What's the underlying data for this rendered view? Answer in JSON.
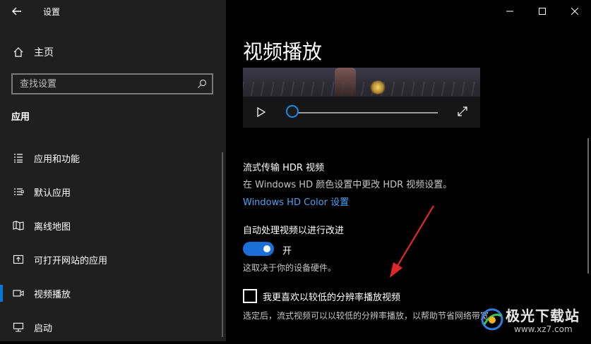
{
  "window": {
    "title": "设置"
  },
  "sidebar": {
    "home_label": "主页",
    "search_placeholder": "查找设置",
    "section_title": "应用",
    "items": [
      {
        "label": "应用和功能",
        "icon": "apps-list-icon"
      },
      {
        "label": "默认应用",
        "icon": "default-apps-icon"
      },
      {
        "label": "离线地图",
        "icon": "offline-map-icon"
      },
      {
        "label": "可打开网站的应用",
        "icon": "open-website-icon"
      },
      {
        "label": "视频播放",
        "icon": "video-playback-icon",
        "active": true
      },
      {
        "label": "启动",
        "icon": "startup-icon"
      }
    ]
  },
  "main": {
    "title": "视频播放",
    "hdr": {
      "title": "流式传输 HDR 视频",
      "desc": "在 Windows HD 颜色设置中更改 HDR 视频设置。",
      "link": "Windows HD Color 设置"
    },
    "auto_process": {
      "title": "自动处理视频以进行改进",
      "toggle_state": "开",
      "toggle_on": true,
      "note": "这取决于你的设备硬件。"
    },
    "low_res": {
      "label": "我更喜欢以较低的分辨率播放视频",
      "checked": false,
      "desc": "选定后，流式视频可以以较低的分辨率播放，以帮助节省网络带宽。"
    }
  },
  "watermark": {
    "text": "极光下载站",
    "url": "www.xz7.com"
  },
  "colors": {
    "accent": "#0078d7",
    "link": "#4aa3f0",
    "arrow": "#e0282a"
  }
}
